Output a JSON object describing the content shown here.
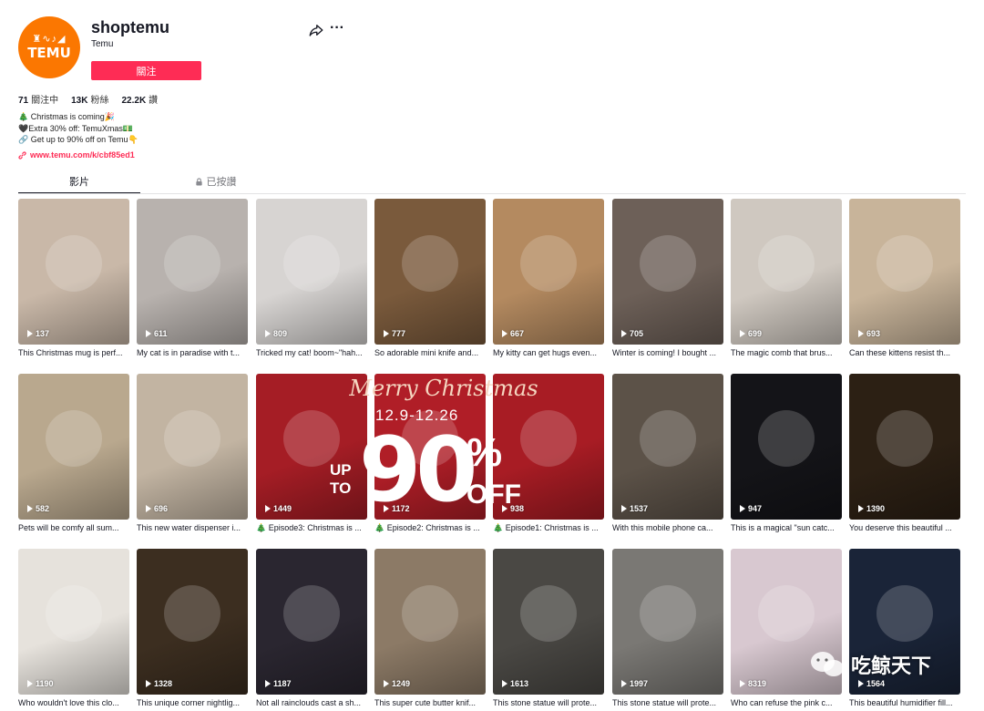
{
  "profile": {
    "username": "shoptemu",
    "nickname": "Temu",
    "avatar_text": "TEMU",
    "avatar_glyphs": "♜∿♪◢",
    "follow_label": "關注",
    "stats": [
      {
        "value": "71",
        "label": "關注中"
      },
      {
        "value": "13K",
        "label": "粉絲"
      },
      {
        "value": "22.2K",
        "label": "讚"
      }
    ],
    "bio_lines": [
      "🎄 Christmas is coming🎉",
      "🖤Extra 30% off: TemuXmas💵",
      "🔗 Get up to 90% off on Temu👇"
    ],
    "link": "www.temu.com/k/cbf85ed1"
  },
  "tabs": {
    "videos": "影片",
    "liked": "已按讚"
  },
  "sale": {
    "script": "Merry Christmas",
    "dates": "12.9-12.26",
    "up": "UP",
    "to": "TO",
    "big": "90",
    "pct": "%",
    "off": "OFF"
  },
  "watermark": {
    "text": "吃鲸天下"
  },
  "videos": [
    {
      "views": "137",
      "caption": "This Christmas mug is perf...",
      "color": "#c9b8a8"
    },
    {
      "views": "611",
      "caption": "My cat is in paradise with t...",
      "color": "#b8b2ae"
    },
    {
      "views": "809",
      "caption": "Tricked my cat! boom~\"hah...",
      "color": "#d7d4d2"
    },
    {
      "views": "777",
      "caption": "So adorable mini knife and...",
      "color": "#7a5a3c"
    },
    {
      "views": "667",
      "caption": "My kitty can get hugs even...",
      "color": "#b48a60"
    },
    {
      "views": "705",
      "caption": "Winter is coming! I bought ...",
      "color": "#6d6058"
    },
    {
      "views": "699",
      "caption": "The magic comb that brus...",
      "color": "#cfc8c0"
    },
    {
      "views": "693",
      "caption": "Can these kittens resist th...",
      "color": "#c8b49a"
    },
    {
      "views": "582",
      "caption": "Pets will be comfy all sum...",
      "color": "#b9a88e"
    },
    {
      "views": "696",
      "caption": "This new water dispenser i...",
      "color": "#c2b4a2"
    },
    {
      "views": "1449",
      "caption": "🎄 Episode3: Christmas is ...",
      "color": "#a51d25"
    },
    {
      "views": "1172",
      "caption": "🎄 Episode2: Christmas is ...",
      "color": "#b01e27"
    },
    {
      "views": "938",
      "caption": "🎄 Episode1: Christmas is ...",
      "color": "#a81c24"
    },
    {
      "views": "1537",
      "caption": "With this mobile phone ca...",
      "color": "#5c5248"
    },
    {
      "views": "947",
      "caption": "This is a magical \"sun catc...",
      "color": "#141418"
    },
    {
      "views": "1390",
      "caption": "You deserve this beautiful ...",
      "color": "#2c2014"
    },
    {
      "views": "1190",
      "caption": "Who wouldn't love this clo...",
      "color": "#e6e2dc"
    },
    {
      "views": "1328",
      "caption": "This unique corner nightlig...",
      "color": "#3c2e20"
    },
    {
      "views": "1187",
      "caption": "Not all rainclouds cast a sh...",
      "color": "#2a2630"
    },
    {
      "views": "1249",
      "caption": "This super cute butter knif...",
      "color": "#8c7a66"
    },
    {
      "views": "1613",
      "caption": "This stone statue will prote...",
      "color": "#4a4844"
    },
    {
      "views": "1997",
      "caption": "This stone statue will prote...",
      "color": "#7a7874"
    },
    {
      "views": "8319",
      "caption": "Who can refuse the pink c...",
      "color": "#d8c8d0"
    },
    {
      "views": "1564",
      "caption": "This beautiful humidifier fill...",
      "color": "#1a2438"
    }
  ]
}
